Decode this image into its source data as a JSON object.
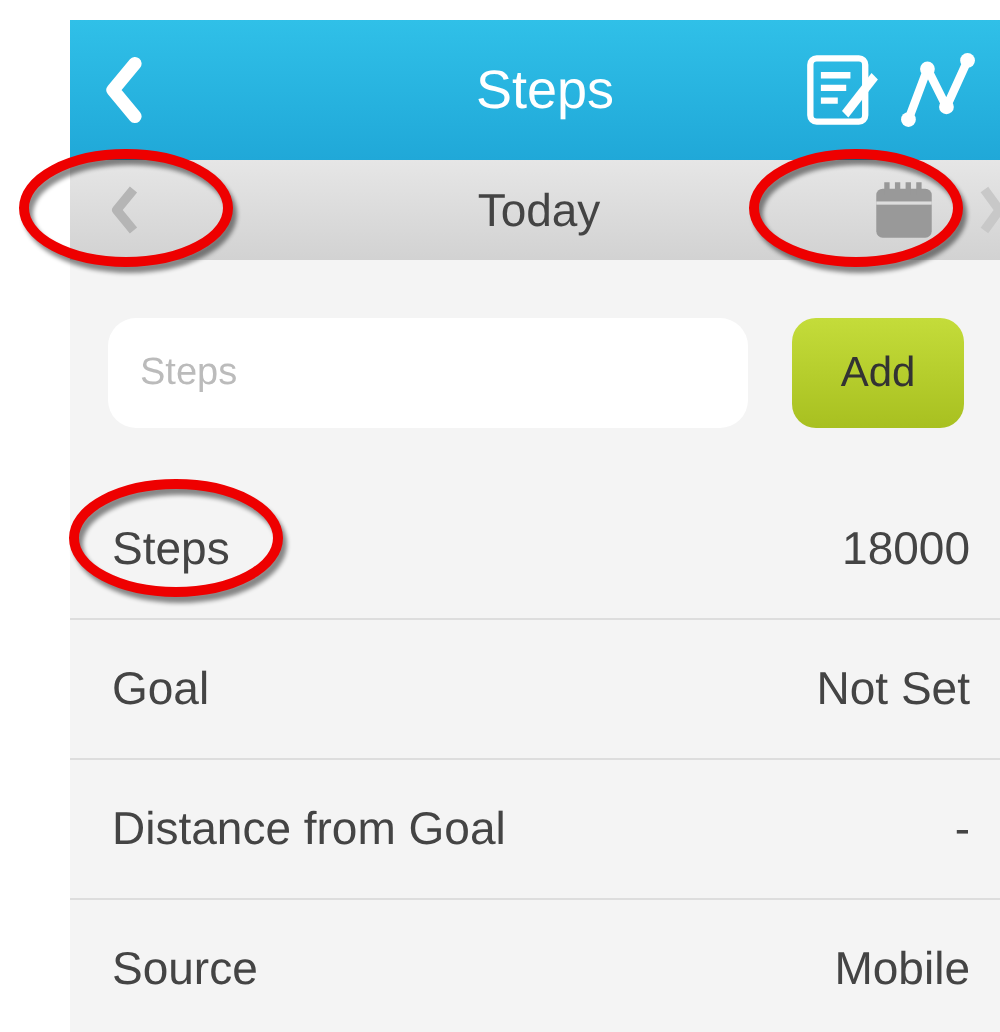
{
  "nav_bar": {
    "title": "Steps"
  },
  "date_bar": {
    "label": "Today",
    "prev_disabled": true,
    "next_disabled": true
  },
  "entry": {
    "placeholder": "Steps",
    "button": "Add"
  },
  "rows": [
    {
      "label": "Steps",
      "value": "18000"
    },
    {
      "label": "Goal",
      "value": "Not Set"
    },
    {
      "label": "Distance from Goal",
      "value": "-"
    },
    {
      "label": "Source",
      "value": "Mobile"
    }
  ]
}
